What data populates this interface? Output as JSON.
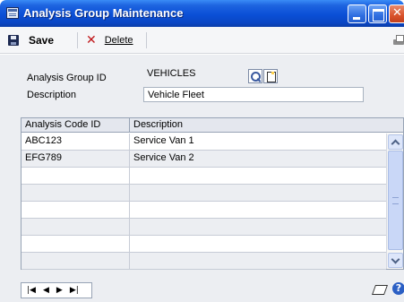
{
  "window": {
    "title": "Analysis Group Maintenance"
  },
  "toolbar": {
    "save_label": "Save",
    "delete_label": "Delete"
  },
  "form": {
    "group_id_label": "Analysis Group ID",
    "group_id_value": "VEHICLES",
    "description_label": "Description",
    "description_value": "Vehicle Fleet"
  },
  "grid": {
    "columns": [
      "Analysis Code ID",
      "Description"
    ],
    "rows": [
      {
        "code": "ABC123",
        "description": "Service Van 1"
      },
      {
        "code": "EFG789",
        "description": "Service Van 2"
      },
      {
        "code": "",
        "description": ""
      },
      {
        "code": "",
        "description": ""
      },
      {
        "code": "",
        "description": ""
      },
      {
        "code": "",
        "description": ""
      },
      {
        "code": "",
        "description": ""
      },
      {
        "code": "",
        "description": ""
      }
    ]
  },
  "navigation": {
    "first": "|◀",
    "prev": "◀",
    "next": "▶",
    "last": "▶|"
  },
  "icons": {
    "app": "form-icon",
    "save": "save-disk-icon",
    "delete": "delete-x-icon",
    "print": "printer-icon",
    "lookup": "magnifier-icon",
    "new": "new-document-icon",
    "note": "note-icon",
    "help": "help-icon"
  },
  "colors": {
    "titlebar": "#0a4fd6",
    "delete": "#c0171a",
    "grid_border": "#97a3b5"
  }
}
